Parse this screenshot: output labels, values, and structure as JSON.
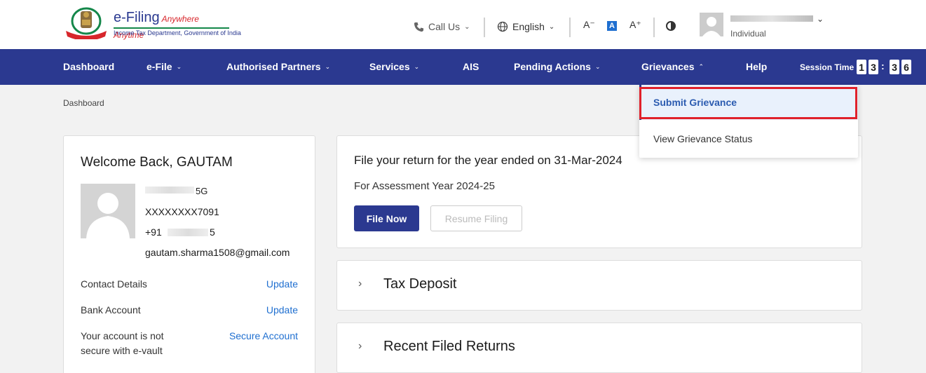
{
  "header": {
    "logo_title": "e-Filing",
    "logo_tagline": "Anywhere Anytime",
    "logo_subtitle": "Income Tax Department, Government of India",
    "call_us": "Call Us",
    "language": "English",
    "font_decrease": "A⁻",
    "font_normal": "A",
    "font_increase": "A⁺",
    "user_role": "Individual"
  },
  "nav": {
    "items": [
      {
        "label": "Dashboard",
        "has_chevron": false
      },
      {
        "label": "e-File",
        "has_chevron": true
      },
      {
        "label": "Authorised Partners",
        "has_chevron": true
      },
      {
        "label": "Services",
        "has_chevron": true
      },
      {
        "label": "AIS",
        "has_chevron": false
      },
      {
        "label": "Pending Actions",
        "has_chevron": true
      },
      {
        "label": "Grievances",
        "has_chevron": true,
        "expanded": true
      },
      {
        "label": "Help",
        "has_chevron": false
      }
    ],
    "session_label": "Session Time",
    "session_digits": [
      "1",
      "3",
      "3",
      "6"
    ]
  },
  "dropdown": {
    "items": [
      "Submit Grievance",
      "View Grievance Status"
    ],
    "highlighted": "Submit Grievance"
  },
  "breadcrumb": "Dashboard",
  "profile": {
    "welcome": "Welcome Back, GAUTAM",
    "name_suffix": "5G",
    "pan": "XXXXXXXX7091",
    "phone_prefix": "+91",
    "phone_suffix": "5",
    "email": "gautam.sharma1508@gmail.com",
    "rows": [
      {
        "label": "Contact Details",
        "action": "Update"
      },
      {
        "label": "Bank Account",
        "action": "Update"
      },
      {
        "label": "Your account is not",
        "label2": "secure with e-vault",
        "action": "Secure Account"
      }
    ]
  },
  "return_card": {
    "title": "File your return for the year ended on 31-Mar-2024",
    "subtitle": "For Assessment Year 2024-25",
    "file_now": "File Now",
    "resume": "Resume Filing"
  },
  "sections": [
    "Tax Deposit",
    "Recent Filed Returns"
  ],
  "colors": {
    "nav_bg": "#2b3990",
    "link": "#1f6fd0",
    "highlight": "#e0212b"
  }
}
